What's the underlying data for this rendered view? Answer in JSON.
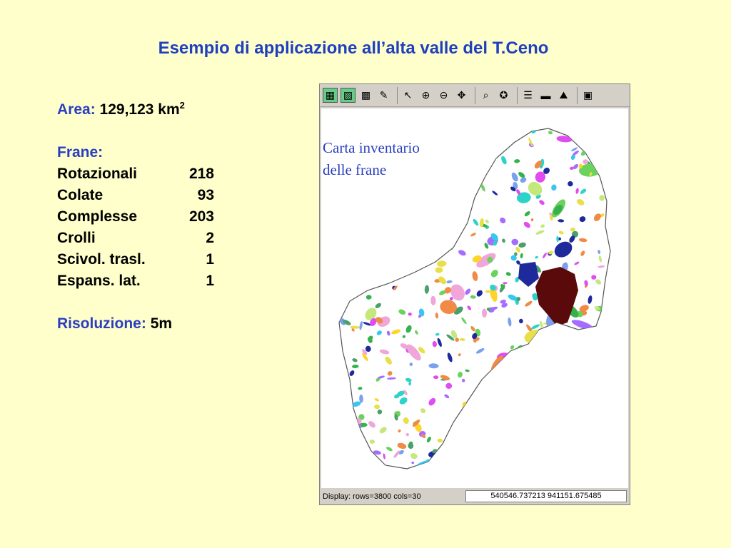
{
  "title": "Esempio di applicazione all’alta valle del T.Ceno",
  "area": {
    "label": "Area:",
    "value": "129,123 km",
    "sup": "2"
  },
  "frane": {
    "label": "Frane:",
    "items": [
      {
        "name": "Rotazionali",
        "count": "218"
      },
      {
        "name": "Colate",
        "count": "93"
      },
      {
        "name": "Complesse",
        "count": "203"
      },
      {
        "name": "Crolli",
        "count": "2"
      },
      {
        "name": "Scivol. trasl.",
        "count": "1"
      },
      {
        "name": "Espans. lat.",
        "count": "1"
      }
    ]
  },
  "risoluzione": {
    "label": "Risoluzione:",
    "value": "5m"
  },
  "map": {
    "caption_line1": "Carta inventario",
    "caption_line2": "delle frane",
    "status": "Display: rows=3800 cols=30",
    "coords": "540546.737213 941151.675485",
    "toolbar_icons": [
      "raster-icon",
      "vector-icon",
      "overlay-icon",
      "edit-icon",
      "pointer-icon",
      "zoom-in-icon",
      "zoom-out-icon",
      "pan-icon",
      "query-icon",
      "analyze-icon",
      "attribute-icon",
      "measure-icon",
      "profile-icon",
      "save-icon"
    ],
    "colors": [
      "#2bd3c8",
      "#35b34a",
      "#f08a45",
      "#ffd42a",
      "#e04cf0",
      "#6bd25e",
      "#1e2a9c",
      "#f0a6d8",
      "#7aa0f0",
      "#a66cff",
      "#e8e04a",
      "#36c8f0",
      "#c4e87c",
      "#4ba06a"
    ],
    "highlight_color": "#5a0a0a"
  }
}
